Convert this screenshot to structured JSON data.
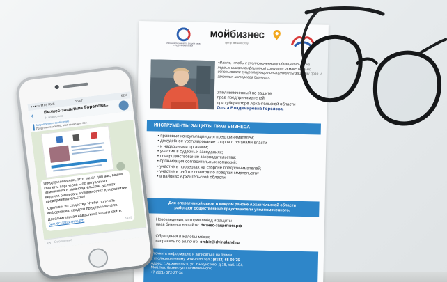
{
  "flyer": {
    "logo_emblem_caption": "УПОЛНОМОЧЕННЫЙ ПО ЗАЩИТЕ ПРАВ ПРЕДПРИНИМАТЕЛЕЙ",
    "logo_brand_1": "мой",
    "logo_brand_2": "бизнес",
    "logo_brand_sub": "центр оказания услуг",
    "quote": "«Важно, чтобы к уполномоченному обращались не на первых шагах конфликтной ситуации, а максимально использовали существующие инструменты защиты прав и законных интересов бизнеса».",
    "ombuds_role_1": "Уполномоченный по защите",
    "ombuds_role_2": "прав предпринимателей",
    "ombuds_role_3": "при губернаторе Архангельской области",
    "ombuds_name": "Ольга Владимировна Горелова.",
    "tools_heading": "ИНСТРУМЕНТЫ ЗАЩИТЫ ПРАВ БИЗНЕСА",
    "tools": [
      "правовые консультации для предпринимателей;",
      "досудебное урегулирование споров с органами власти",
      "и надзорными органами;",
      "участие в судебных заседаниях;",
      "совершенствование законодательства;",
      "организация согласительных комиссий;",
      "участие в проверках на стороне предпринимателей;",
      "участие в работе советов по предпринимательству",
      "в районах Архангельской области."
    ],
    "reps_line_1": "Для оперативной связи в каждом районе Архангельской области",
    "reps_line_2": "работают общественные представители уполномоченного.",
    "news_line_1": "Нововведения, истории побед и защиты",
    "news_line_2": "прав бизнеса на сайте:",
    "news_site": "бизнес-защитник.рф",
    "complaints_line_1": "Обращения и жалобы можно",
    "complaints_line_2": "направить по эл.почте:",
    "complaints_email": "ombiz@dvinaland.ru",
    "contact_line_1": "Уточнить информацию и записаться на прием",
    "contact_line_2": "к уполномоченному можно по тел.:",
    "contact_phone": "(8182) 65-09-75",
    "contact_address": "Адрес: г. Архангельск, ул. Вычуйского, д.18, каб. 104.",
    "contact_mobile_label": "Моб.тел. бизнес-уполномоченного:",
    "contact_mobile": "+7 (921) 672-27-34"
  },
  "phone": {
    "status_left": "●●●○○ MTS RUS",
    "status_time": "16:07",
    "status_right": "62%",
    "chat_title": "Бизнес-защитник Горелова...",
    "chat_subtitle": "34 подписчика",
    "back_glyph": "‹",
    "pinned_label": "Закреплённое сообщение",
    "pinned_text": "Предпринимателей, этот канал для вас...",
    "message": [
      "Предприниматели, этот канал для вас, ваших коллег и партнеров – об актуальных изменениях в законодательстве, услугах ведения бизнеса и возможностях для развития предпринимательства!",
      "Коротко и по существу. Чтобы получать информацию каждого предпринимателя.",
      "Дополнительная навостинка нашем сайте:"
    ],
    "message_link": "бизнес-защитник.рф",
    "message_time": "16:05",
    "input_placeholder": "Сообщение",
    "clip_glyph": "⊘"
  }
}
